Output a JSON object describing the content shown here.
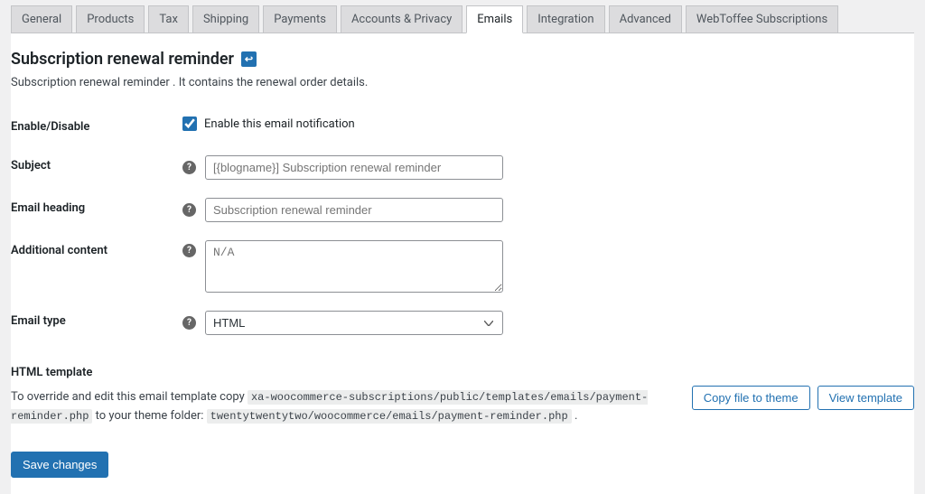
{
  "tabs": [
    {
      "label": "General"
    },
    {
      "label": "Products"
    },
    {
      "label": "Tax"
    },
    {
      "label": "Shipping"
    },
    {
      "label": "Payments"
    },
    {
      "label": "Accounts & Privacy"
    },
    {
      "label": "Emails"
    },
    {
      "label": "Integration"
    },
    {
      "label": "Advanced"
    },
    {
      "label": "WebToffee Subscriptions"
    }
  ],
  "active_tab_index": 6,
  "title": "Subscription renewal reminder",
  "description": "Subscription renewal reminder . It contains the renewal order details.",
  "fields": {
    "enable": {
      "label": "Enable/Disable",
      "checkbox_label": "Enable this email notification",
      "checked": true
    },
    "subject": {
      "label": "Subject",
      "placeholder": "[{blogname}] Subscription renewal reminder",
      "value": ""
    },
    "heading": {
      "label": "Email heading",
      "placeholder": "Subscription renewal reminder",
      "value": ""
    },
    "additional": {
      "label": "Additional content",
      "placeholder": "N/A",
      "value": ""
    },
    "email_type": {
      "label": "Email type",
      "selected": "HTML"
    }
  },
  "template": {
    "title": "HTML template",
    "pre_text": "To override and edit this email template copy ",
    "path1": "xa-woocommerce-subscriptions/public/templates/emails/payment-reminder.php",
    "mid_text": " to your theme folder: ",
    "path2": "twentytwentytwo/woocommerce/emails/payment-reminder.php",
    "post_text": " .",
    "copy_button": "Copy file to theme",
    "view_button": "View template"
  },
  "save_button": "Save changes",
  "help_glyph": "?"
}
